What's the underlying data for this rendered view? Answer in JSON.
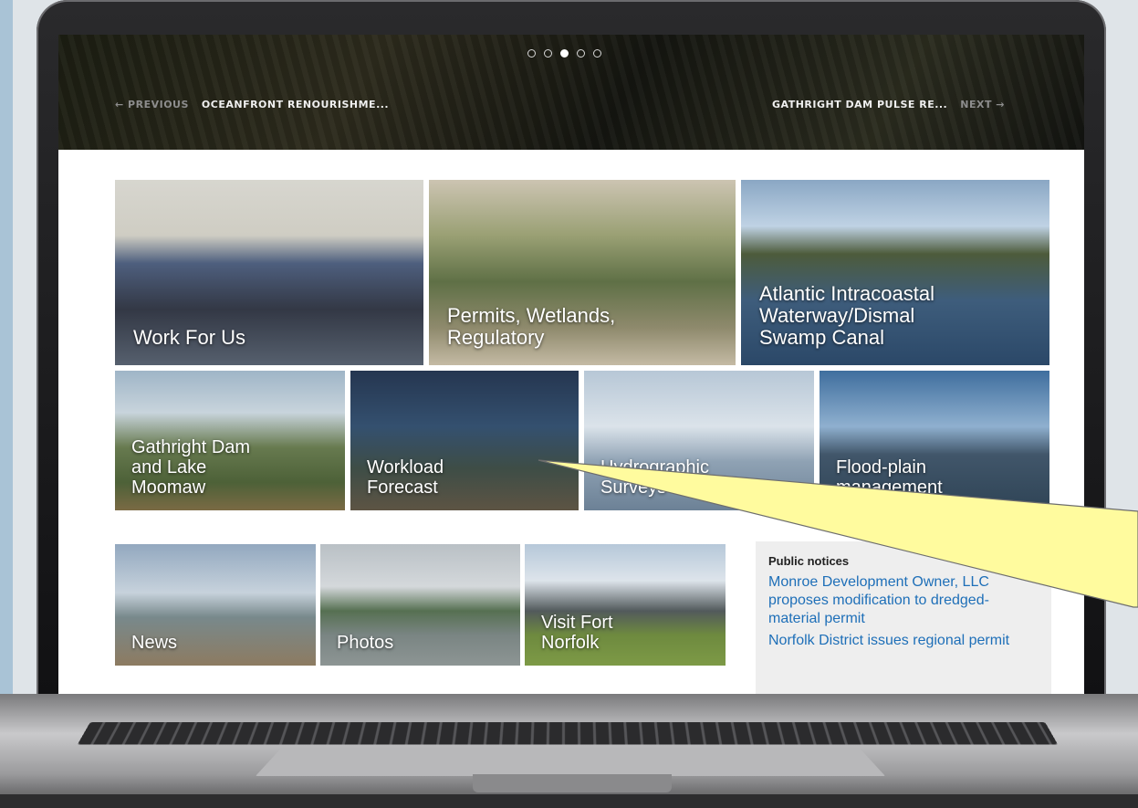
{
  "carousel": {
    "dots": [
      false,
      false,
      true,
      false,
      false
    ],
    "previous_label": "← PREVIOUS",
    "previous_title": "OCEANFRONT RENOURISHME...",
    "next_title": "GATHRIGHT DAM PULSE RE...",
    "next_label": "NEXT →"
  },
  "tiles": {
    "work_for_us": "Work For Us",
    "permits": "Permits, Wetlands,\nRegulatory",
    "aiww": "Atlantic Intracoastal\nWaterway/Dismal\nSwamp Canal",
    "gathright": "Gathright Dam\nand Lake\nMoomaw",
    "workload": "Workload\nForecast",
    "hydrographic": "Hydrographic\nSurveys",
    "floodplain": "Flood-plain\nmanagement",
    "news": "News",
    "photos": "Photos",
    "fort_norfolk": "Visit Fort\nNorfolk"
  },
  "notices": {
    "title": "Public notices",
    "items": [
      "Monroe Development Owner, LLC proposes modification to dredged-material permit",
      "Norfolk District issues regional permit"
    ]
  },
  "colors": {
    "link": "#1e6fb8",
    "callout_fill": "#fffb9e",
    "laptop_frame": "#1b1b1d"
  }
}
